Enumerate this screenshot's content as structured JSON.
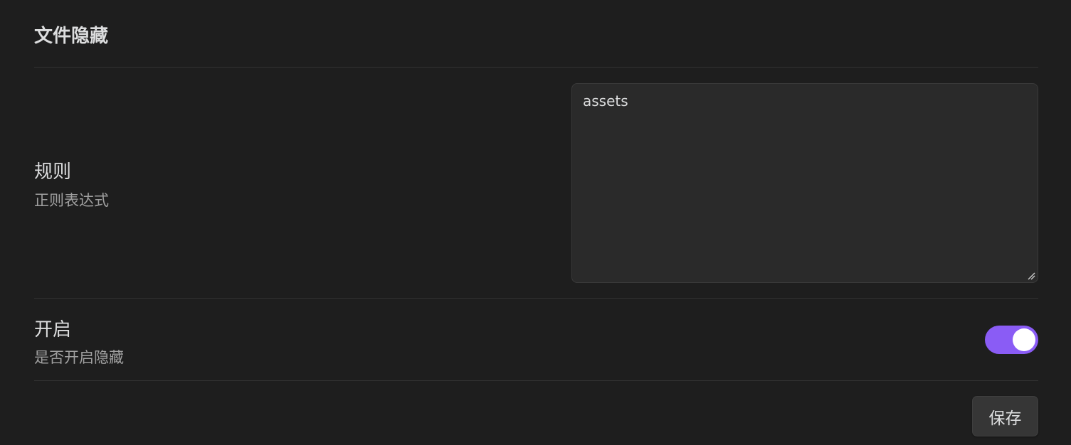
{
  "section": {
    "title": "文件隐藏"
  },
  "rules": {
    "name": "规则",
    "description": "正则表达式",
    "value": "assets"
  },
  "enable": {
    "name": "开启",
    "description": "是否开启隐藏",
    "enabled": true,
    "accent_color": "#8a5cf5"
  },
  "actions": {
    "save_label": "保存"
  }
}
